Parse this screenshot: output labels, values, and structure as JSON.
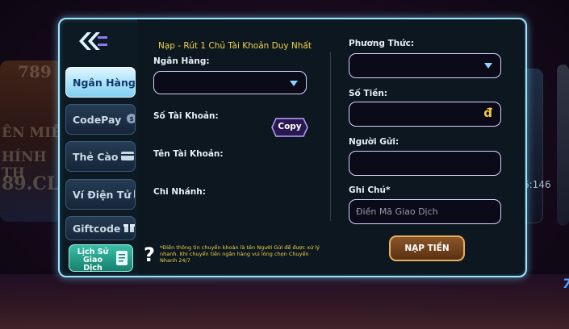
{
  "background": {
    "left_text": [
      "789",
      "ÊN MIỀ",
      "HÍNH TH",
      "89.CL"
    ],
    "right_text": "6:146",
    "corner_text": "7"
  },
  "sidebar": {
    "tabs": [
      {
        "label": "Ngân Hàng",
        "icon": "bank-icon",
        "active": true
      },
      {
        "label": "CodePay",
        "icon": "coin-icon",
        "active": false
      },
      {
        "label": "Thẻ Cào",
        "icon": "card-icon",
        "active": false
      },
      {
        "label": "Ví Điện Tử",
        "icon": "wallet-icon",
        "active": false
      },
      {
        "label": "Giftcode",
        "icon": "gift-icon",
        "active": false
      }
    ],
    "history_label": "Lịch Sử Giao Dịch"
  },
  "left_column": {
    "title": "Nạp - Rút 1 Chủ Tài Khoản Duy Nhất",
    "bank_label": "Ngân Hàng:",
    "bank_value": "",
    "account_number_label": "Số Tài Khoản:",
    "copy_label": "Copy",
    "account_name_label": "Tên Tài Khoản:",
    "branch_label": "Chi Nhánh:"
  },
  "right_column": {
    "method_label": "Phương Thức:",
    "method_value": "",
    "amount_label": "Số Tiền:",
    "amount_value": "",
    "currency_symbol": "đ",
    "sender_label": "Người Gửi:",
    "sender_value": "",
    "note_label": "Ghi Chú*",
    "note_placeholder": "Điền Mã Giao Dịch",
    "submit_label": "NẠP TIỀN"
  },
  "footer_note": "*Điền thông tin chuyển khoản là tên Người Gửi để được xử lý nhanh. Khi chuyển tiền ngân hàng vui lòng chọn Chuyển Nhanh 24/7",
  "colors": {
    "accent": "#9fe3ff",
    "title_yellow": "#f0d34a",
    "submit_border": "#e6b05a"
  }
}
